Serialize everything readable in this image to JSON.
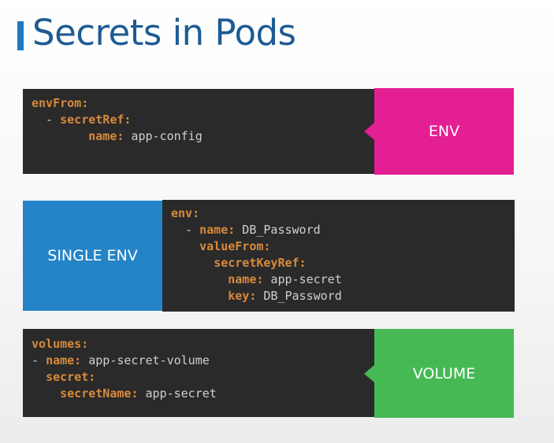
{
  "title": "Secrets in Pods",
  "colors": {
    "title_accent": "#1f79c0",
    "title_text": "#1d5b93",
    "code_bg": "#2a2a2a",
    "key": "#d78a3c",
    "env_tag": "#e41e93",
    "single_env_tag": "#2484c7",
    "volume_tag": "#46b955"
  },
  "blocks": {
    "env_from": {
      "tag": "ENV",
      "lines": [
        {
          "indent": "",
          "dash": "",
          "key": "envFrom",
          "value": ""
        },
        {
          "indent": "  ",
          "dash": "- ",
          "key": "secretRef",
          "value": ""
        },
        {
          "indent": "        ",
          "dash": "",
          "key": "name",
          "value": "app-config"
        }
      ]
    },
    "single_env": {
      "tag": "SINGLE ENV",
      "lines": [
        {
          "indent": "",
          "dash": "",
          "key": "env",
          "value": ""
        },
        {
          "indent": "  ",
          "dash": "- ",
          "key": "name",
          "value": "DB_Password"
        },
        {
          "indent": "    ",
          "dash": "",
          "key": "valueFrom",
          "value": ""
        },
        {
          "indent": "      ",
          "dash": "",
          "key": "secretKeyRef",
          "value": ""
        },
        {
          "indent": "        ",
          "dash": "",
          "key": "name",
          "value": "app-secret"
        },
        {
          "indent": "        ",
          "dash": "",
          "key": "key",
          "value": "DB_Password"
        }
      ]
    },
    "volume": {
      "tag": "VOLUME",
      "lines": [
        {
          "indent": "",
          "dash": "",
          "key": "volumes",
          "value": ""
        },
        {
          "indent": "",
          "dash": "- ",
          "key": "name",
          "value": "app-secret-volume"
        },
        {
          "indent": "  ",
          "dash": "",
          "key": "secret",
          "value": ""
        },
        {
          "indent": "    ",
          "dash": "",
          "key": "secretName",
          "value": "app-secret"
        }
      ]
    }
  }
}
